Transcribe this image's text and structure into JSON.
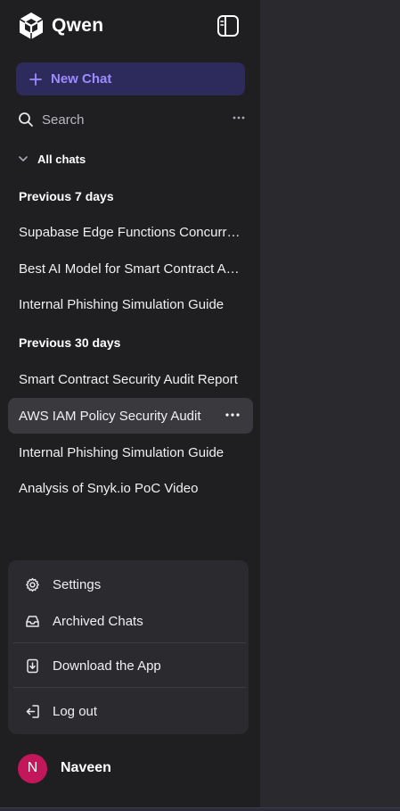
{
  "app": {
    "name": "Qwen"
  },
  "new_chat": {
    "label": "New Chat"
  },
  "search": {
    "label": "Search"
  },
  "all_chats": {
    "label": "All chats"
  },
  "sections": [
    {
      "title": "Previous 7 days",
      "items": [
        "Supabase Edge Functions Concurrency",
        "Best AI Model for Smart Contract Audits",
        "Internal Phishing Simulation Guide"
      ]
    },
    {
      "title": "Previous 30 days",
      "items": [
        "Smart Contract Security Audit Report",
        "AWS IAM Policy Security Audit",
        "Internal Phishing Simulation Guide",
        "Analysis of Snyk.io PoC Video"
      ]
    }
  ],
  "active_chat": "AWS IAM Policy Security Audit",
  "menu": {
    "settings": "Settings",
    "archived": "Archived Chats",
    "download": "Download the App",
    "logout": "Log out"
  },
  "user": {
    "initial": "N",
    "name": "Naveen",
    "avatar_color": "#c2185b"
  },
  "colors": {
    "sidebar_bg": "#1f1f22",
    "main_bg": "#2a2a2e",
    "accent": "#9d8cff",
    "new_chat_bg": "#2d2a5c",
    "active_item_bg": "#3a3a3e"
  },
  "icons": [
    "qwen-logo-icon",
    "sidebar-toggle-icon",
    "plus-icon",
    "search-icon",
    "more-icon",
    "chevron-down-icon",
    "gear-icon",
    "archive-icon",
    "download-icon",
    "logout-icon"
  ]
}
